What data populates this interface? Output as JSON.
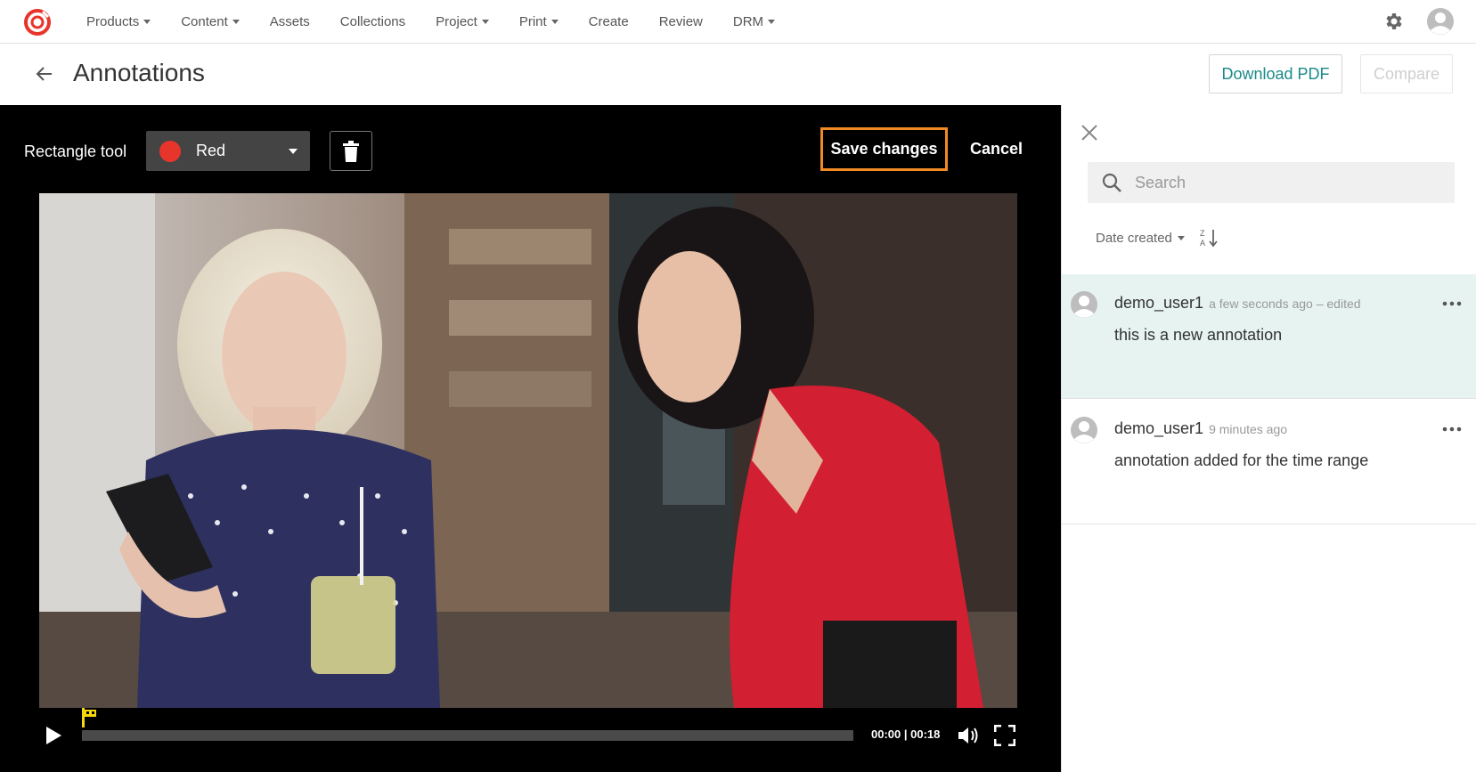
{
  "nav": {
    "items": [
      {
        "label": "Products",
        "dropdown": true
      },
      {
        "label": "Content",
        "dropdown": true
      },
      {
        "label": "Assets",
        "dropdown": false
      },
      {
        "label": "Collections",
        "dropdown": false
      },
      {
        "label": "Project",
        "dropdown": true
      },
      {
        "label": "Print",
        "dropdown": true
      },
      {
        "label": "Create",
        "dropdown": false
      },
      {
        "label": "Review",
        "dropdown": false
      },
      {
        "label": "DRM",
        "dropdown": true
      }
    ],
    "brand_color": "#e8352c"
  },
  "header": {
    "title": "Annotations",
    "download_label": "Download PDF",
    "compare_label": "Compare"
  },
  "toolbar": {
    "tool_label": "Rectangle tool",
    "color_name": "Red",
    "color_hex": "#e8352c",
    "save_label": "Save changes",
    "cancel_label": "Cancel",
    "highlight_color": "#f08a24"
  },
  "player": {
    "time": "00:00 | 00:18",
    "progress": 0.0,
    "marker_color": "#f5d90a"
  },
  "panel": {
    "search_placeholder": "Search",
    "sort_label": "Date created",
    "comments": [
      {
        "user": "demo_user1",
        "meta": "a few seconds ago – edited",
        "text": "this is a new annotation",
        "active": true
      },
      {
        "user": "demo_user1",
        "meta": "9 minutes ago",
        "text": "annotation added for the time range",
        "active": false
      }
    ]
  }
}
